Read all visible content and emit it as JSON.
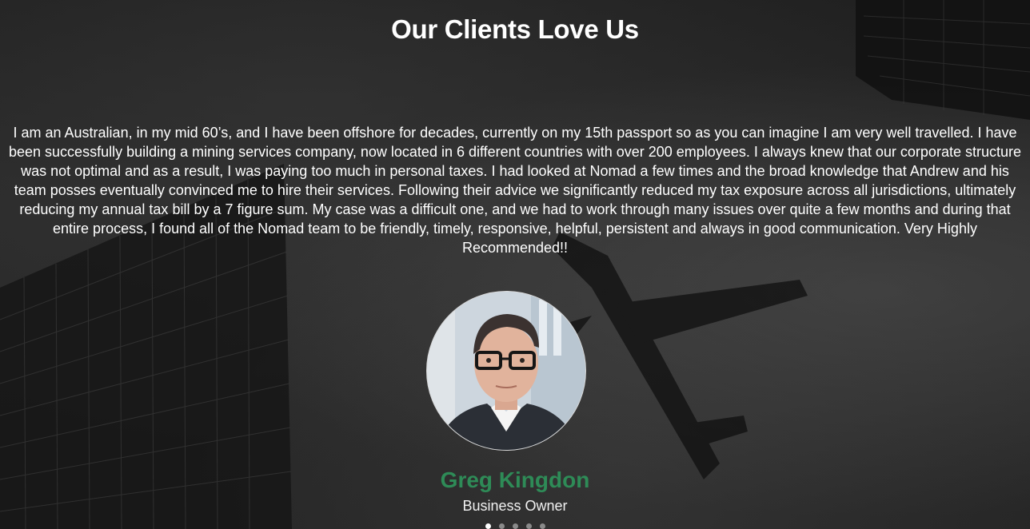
{
  "testimonials": {
    "heading": "Our Clients Love Us",
    "quote": "I am an Australian, in my mid 60’s, and I have been offshore for decades, currently on my 15th passport so as you can imagine I am very well travelled. I have been successfully building a mining services company, now located in 6 different countries with over 200 employees. I always knew that our corporate structure was not optimal and as a result, I was paying too much in personal taxes. I had looked at Nomad a few times and the broad knowledge that Andrew and his team posses eventually convinced me to hire their services. Following their advice we significantly reduced my tax exposure across all jurisdictions, ultimately reducing my annual tax bill by a 7 figure sum. My case was a difficult one, and we had to work through many issues over quite a few months and during that entire process, I found all of the Nomad team to be friendly, timely, responsive, helpful, persistent and always in good communication. Very Highly Recommended!!",
    "author_name": "Greg Kingdon",
    "author_role": "Business Owner",
    "slide_count": 5,
    "active_slide": 1
  },
  "colors": {
    "name_accent": "#2e8b57",
    "dot_active": "#ffffff",
    "dot_inactive": "#8a8a8a"
  }
}
